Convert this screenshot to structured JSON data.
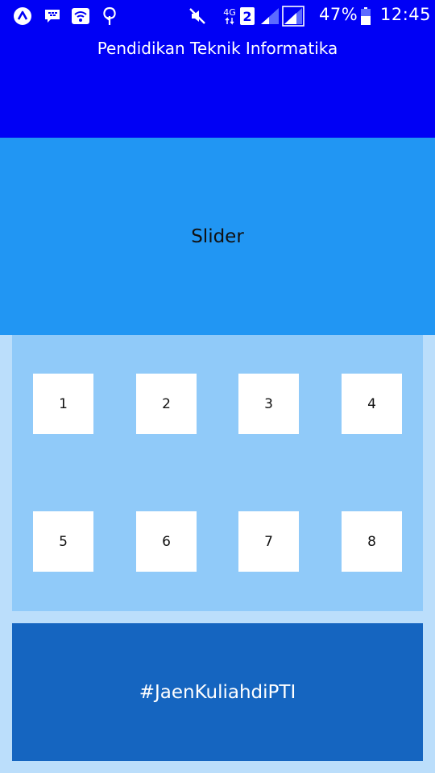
{
  "status_bar": {
    "network_label": "4G",
    "sim_label": "2",
    "battery_percent": "47%",
    "time": "12:45",
    "icons": [
      "app-a-icon",
      "bbm-icon",
      "wifi-hotspot-icon",
      "tree-icon",
      "mute-icon",
      "network-4g-icon",
      "sim-2-icon",
      "signal-icon",
      "signal-icon",
      "battery-icon"
    ]
  },
  "header": {
    "title": "Pendidikan Teknik Informatika",
    "color": "#0000f5"
  },
  "slider": {
    "label": "Slider",
    "color": "#2196f3"
  },
  "menu": {
    "items": [
      {
        "label": "1"
      },
      {
        "label": "2"
      },
      {
        "label": "3"
      },
      {
        "label": "4"
      },
      {
        "label": "5"
      },
      {
        "label": "6"
      },
      {
        "label": "7"
      },
      {
        "label": "8"
      }
    ],
    "panel_color": "#90caf9"
  },
  "banner": {
    "text": "#JaenKuliahdiPTI",
    "color": "#1565c0"
  },
  "page_background": "#bbdefb"
}
